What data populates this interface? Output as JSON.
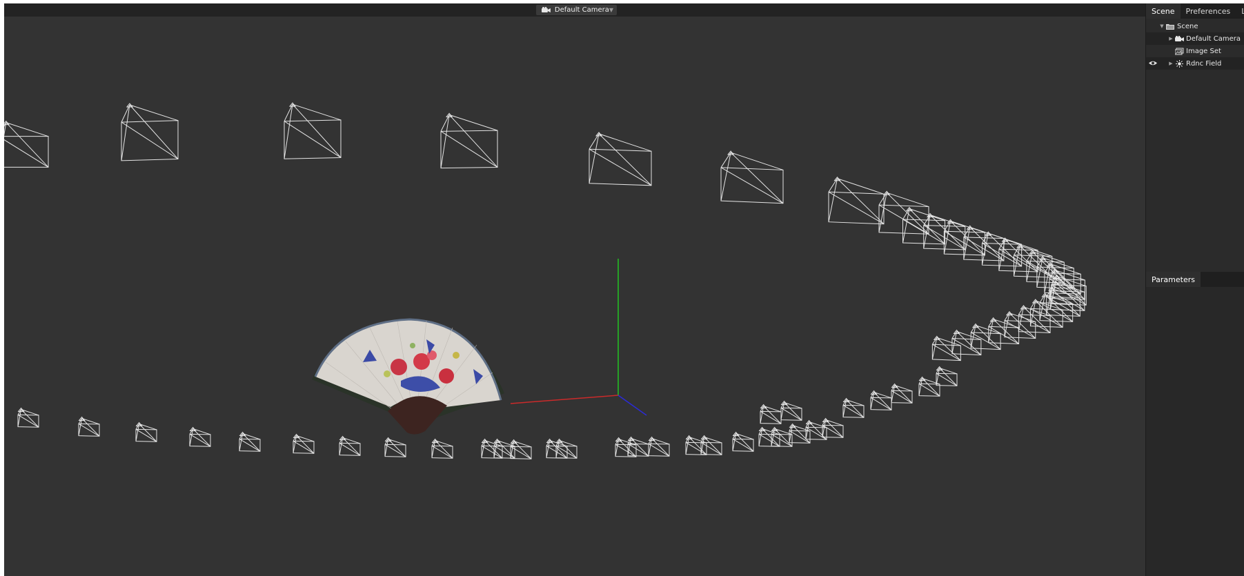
{
  "viewport": {
    "camera_selector": {
      "label": "Default Camera",
      "icon": "video-camera-icon",
      "chevron": "▼"
    }
  },
  "panel": {
    "tabs": [
      {
        "label": "Scene",
        "active": true
      },
      {
        "label": "Preferences",
        "active": false
      },
      {
        "label": "Lo",
        "active": false
      }
    ],
    "tree": [
      {
        "label": "Scene",
        "icon": "folder-icon",
        "expander": "▼",
        "visible_toggle": false
      },
      {
        "label": "Default Camera",
        "icon": "video-camera-icon",
        "expander": "▶",
        "visible_toggle": false
      },
      {
        "label": "Image Set",
        "icon": "images-icon",
        "expander": "",
        "visible_toggle": false
      },
      {
        "label": "Rdnc Field",
        "icon": "sun-icon",
        "expander": "▶",
        "visible_toggle": true
      }
    ],
    "params_tab": {
      "label": "Parameters"
    }
  },
  "colors": {
    "viewport_bg": "#333333",
    "panel_bg": "#2b2b2b",
    "wireframe": "#e8e8e8",
    "axis_x": "#d22a2a",
    "axis_y": "#2ad22a",
    "axis_z": "#2a2ad2"
  }
}
